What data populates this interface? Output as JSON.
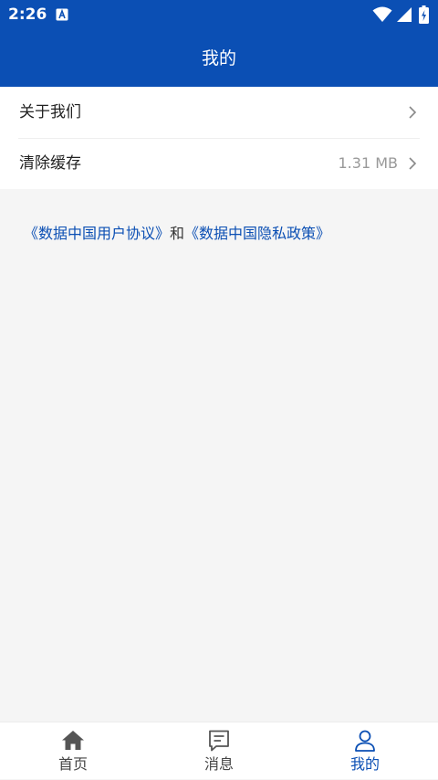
{
  "status_bar": {
    "time": "2:26",
    "icons": [
      "app-notification-icon",
      "wifi-icon",
      "signal-icon",
      "battery-icon"
    ]
  },
  "header": {
    "title": "我的"
  },
  "menu": {
    "items": [
      {
        "label": "关于我们",
        "value": ""
      },
      {
        "label": "清除缓存",
        "value": "1.31 MB"
      }
    ]
  },
  "agreement": {
    "user_agreement": "《数据中国用户协议》",
    "connector": "和",
    "privacy_policy": "《数据中国隐私政策》"
  },
  "tabs": [
    {
      "label": "首页",
      "icon": "home-icon"
    },
    {
      "label": "消息",
      "icon": "message-icon"
    },
    {
      "label": "我的",
      "icon": "person-icon"
    }
  ],
  "colors": {
    "primary": "#0b4fb4",
    "background": "#f5f5f5",
    "text": "#222222",
    "secondary_text": "#999999"
  }
}
